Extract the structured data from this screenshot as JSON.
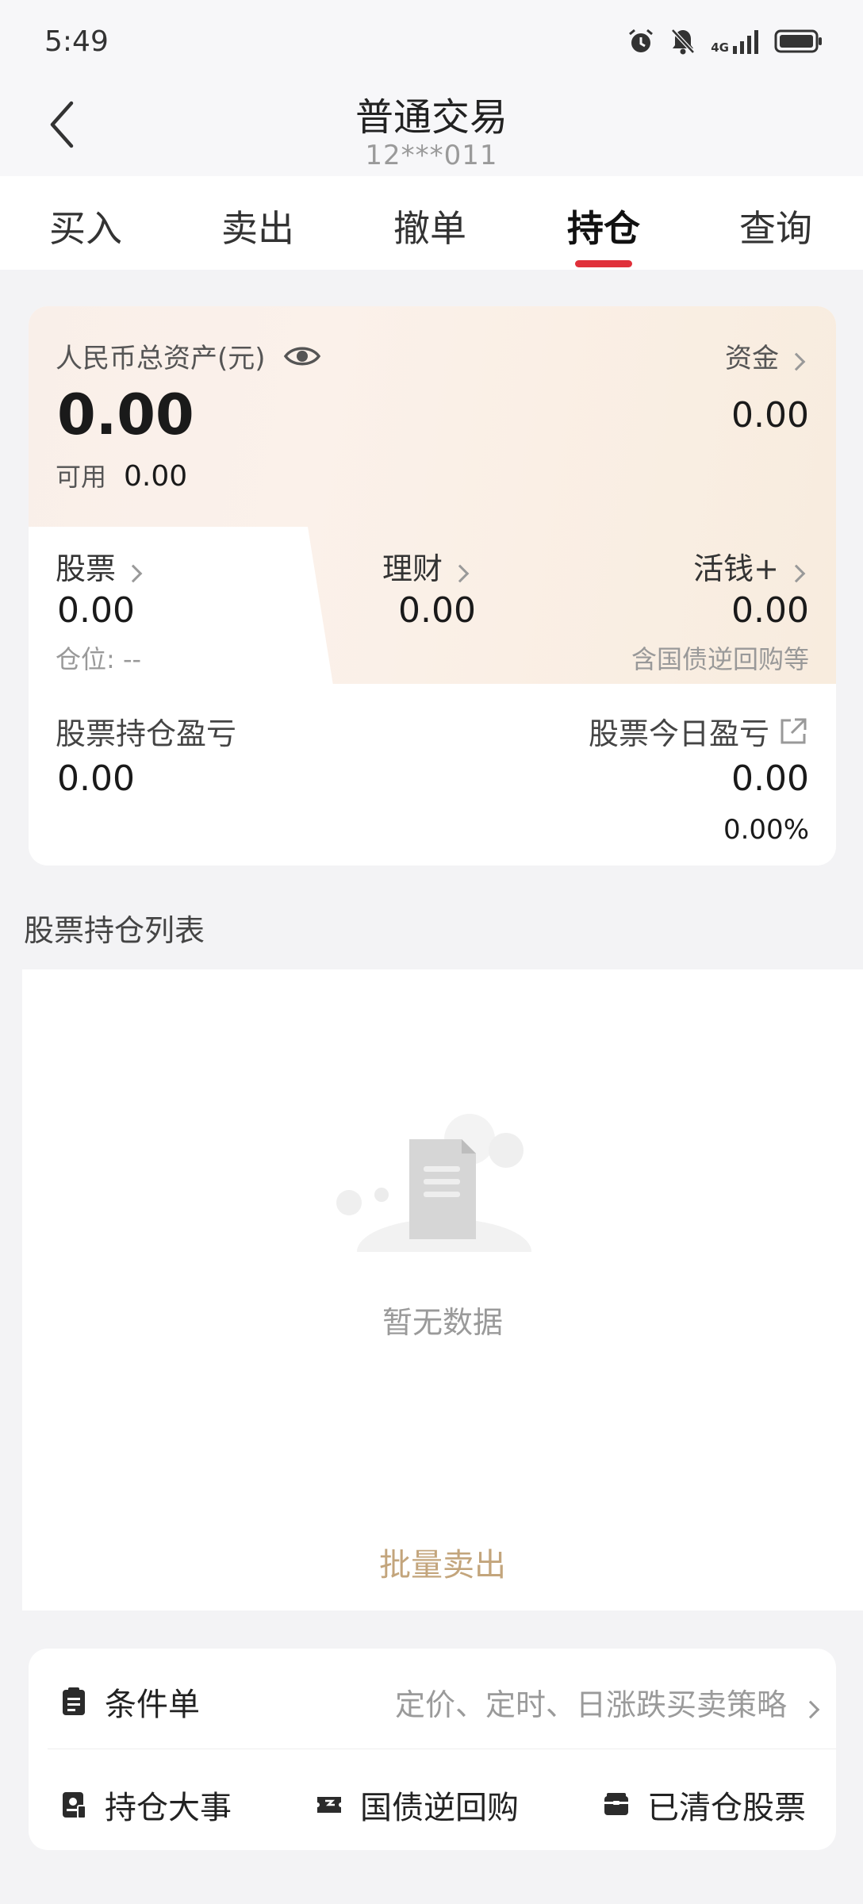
{
  "status_bar": {
    "time": "5:49",
    "network": "4G"
  },
  "header": {
    "title": "普通交易",
    "account": "12***011"
  },
  "tabs": [
    {
      "label": "买入",
      "active": false
    },
    {
      "label": "卖出",
      "active": false
    },
    {
      "label": "撤单",
      "active": false
    },
    {
      "label": "持仓",
      "active": true
    },
    {
      "label": "查询",
      "active": false
    }
  ],
  "assets": {
    "total_label": "人民币总资产(元)",
    "total_value": "0.00",
    "available_label": "可用",
    "available_value": "0.00",
    "funds_label": "资金",
    "funds_value": "0.00",
    "stock_label": "股票",
    "stock_value": "0.00",
    "position_label": "仓位: --",
    "wealth_label": "理财",
    "wealth_value": "0.00",
    "flex_label": "活钱+",
    "flex_value": "0.00",
    "flex_note": "含国债逆回购等",
    "holding_pl_label": "股票持仓盈亏",
    "holding_pl_value": "0.00",
    "today_pl_label": "股票今日盈亏",
    "today_pl_value": "0.00",
    "today_pl_pct": "0.00%"
  },
  "positions": {
    "title": "股票持仓列表",
    "empty_text": "暂无数据",
    "batch_sell": "批量卖出"
  },
  "tools": {
    "condition_order_label": "条件单",
    "condition_order_desc": "定价、定时、日涨跌买卖策略",
    "events_label": "持仓大事",
    "repo_label": "国债逆回购",
    "cleared_label": "已清仓股票"
  },
  "colors": {
    "accent_red": "#e0303a",
    "gold": "#c3a57c",
    "card_gradient": "#f8ecde"
  }
}
